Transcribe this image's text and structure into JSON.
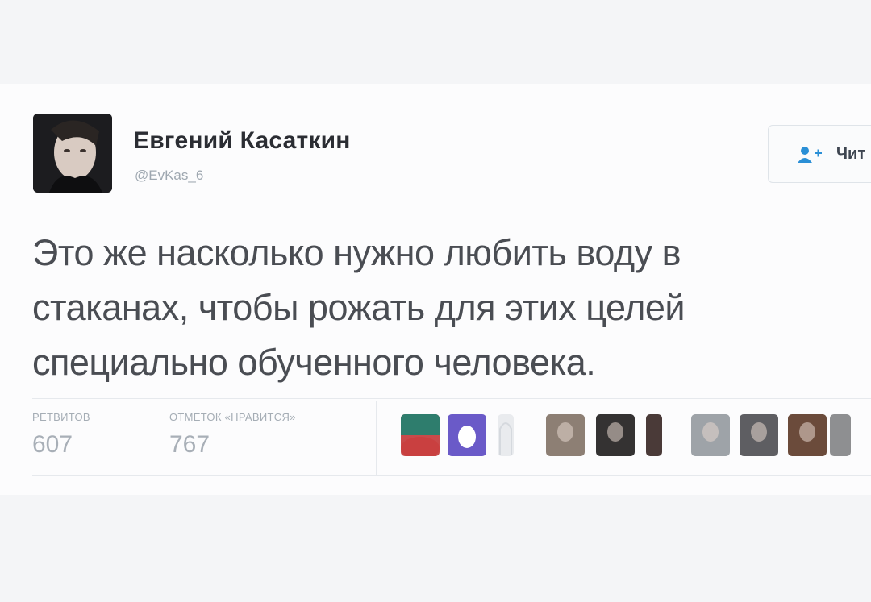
{
  "user": {
    "display_name": "Евгений Касаткин",
    "handle": "@EvKas_6"
  },
  "follow_button": {
    "label": "Чит"
  },
  "tweet": {
    "text_lines": [
      "Это же насколько нужно любить воду в",
      "стаканах, чтобы рожать для этих целей",
      "специально обученного человека."
    ]
  },
  "stats": {
    "retweets_label": "РЕТВИТОВ",
    "retweets_value": "607",
    "likes_label": "ОТМЕТОК «НРАВИТСЯ»",
    "likes_value": "767"
  },
  "likers": [
    {
      "icon": "liker-avatar-red-icon",
      "color": "#c84a4a"
    },
    {
      "icon": "liker-avatar-egg-icon",
      "color": "#6a5ac8"
    },
    {
      "icon": "liker-avatar-ghost-icon",
      "color": "#e9ebee"
    },
    {
      "icon": "liker-avatar-photo-icon",
      "color": "#8d7f74"
    },
    {
      "icon": "liker-avatar-photo-icon",
      "color": "#343232"
    },
    {
      "icon": "liker-avatar-photo-icon",
      "color": "#4a3a38"
    },
    {
      "icon": "liker-avatar-photo-icon",
      "color": "#9ea3a8"
    },
    {
      "icon": "liker-avatar-photo-icon",
      "color": "#5e5e62"
    },
    {
      "icon": "liker-avatar-photo-icon",
      "color": "#6b4b3b"
    },
    {
      "icon": "liker-avatar-photo-icon",
      "color": "#8e8f91"
    }
  ]
}
